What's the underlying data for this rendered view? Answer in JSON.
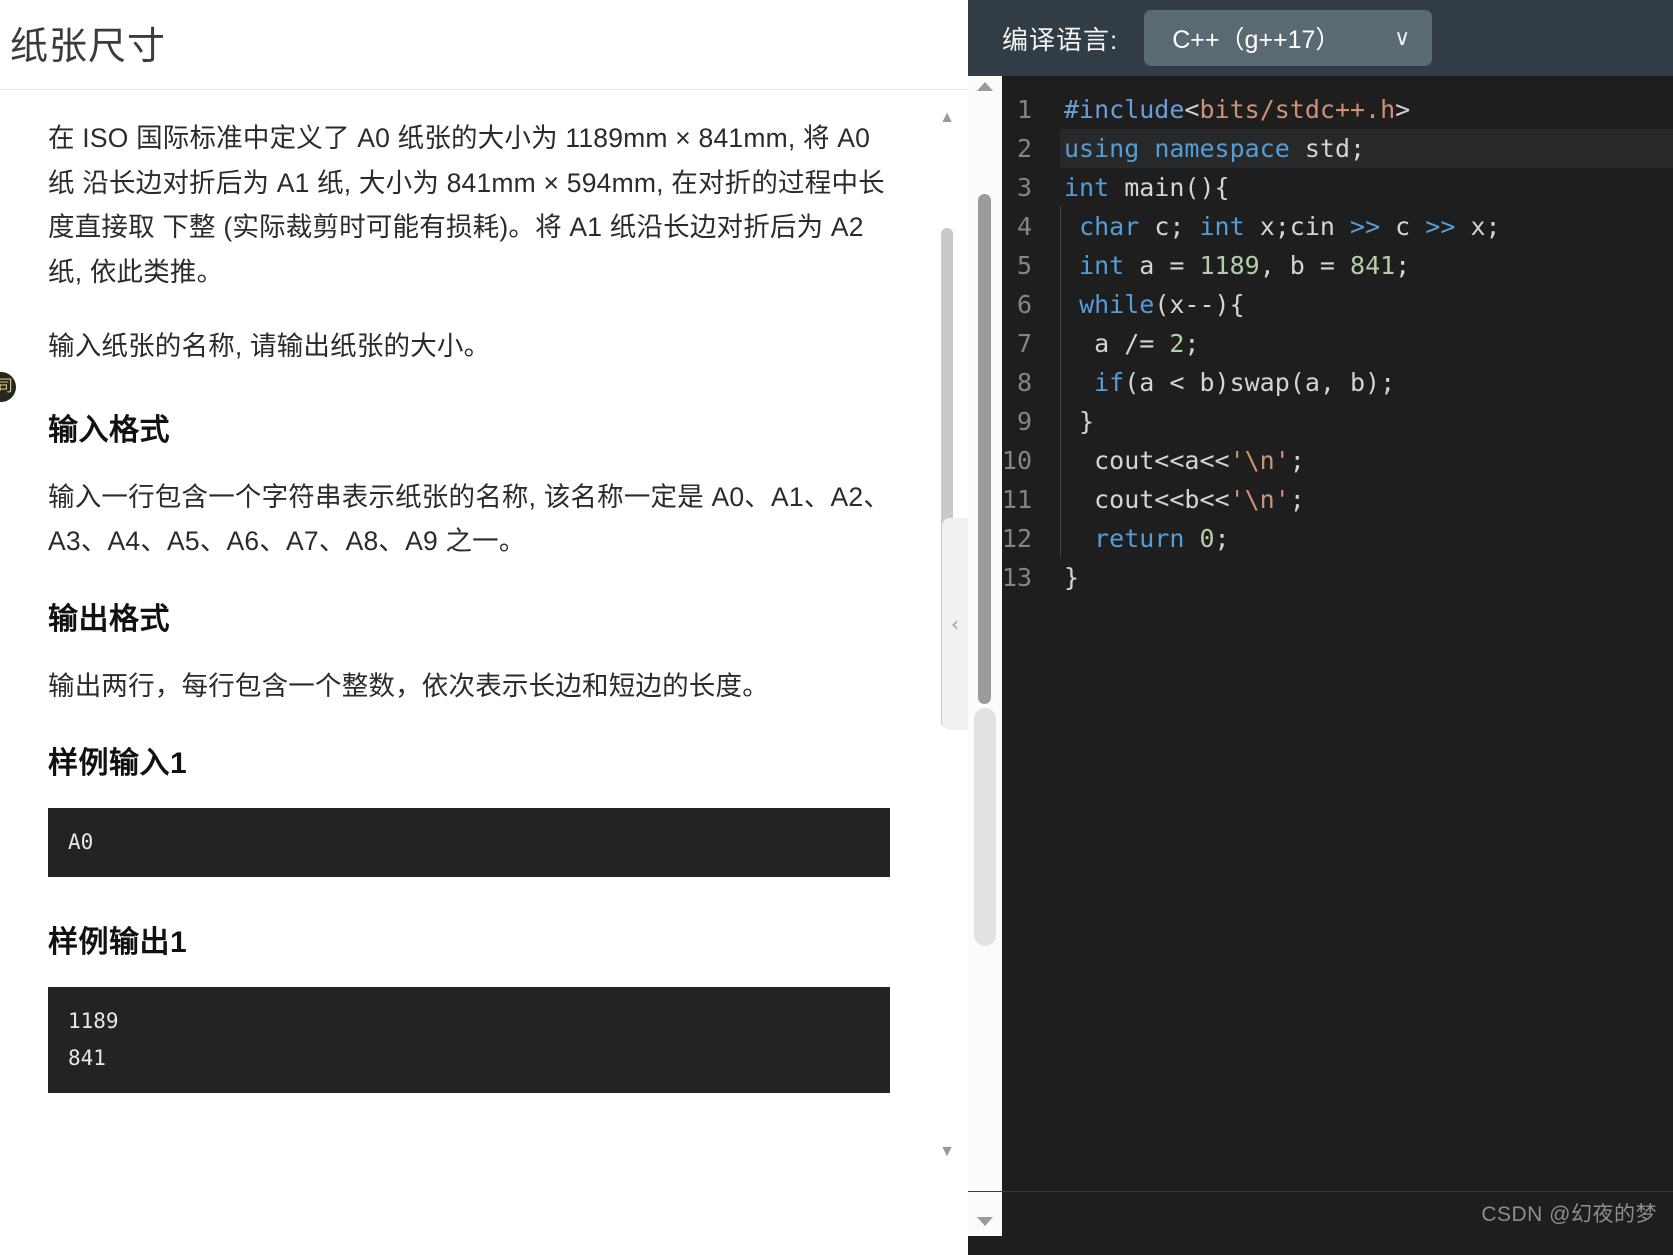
{
  "problem": {
    "title": "纸张尺寸",
    "paragraphs": [
      "在 ISO 国际标准中定义了 A0 纸张的大小为 1189mm × 841mm, 将 A0 纸 沿长边对折后为 A1 纸, 大小为 841mm × 594mm, 在对折的过程中长度直接取 下整 (实际裁剪时可能有损耗)。将 A1 纸沿长边对折后为 A2 纸, 依此类推。",
      "输入纸张的名称, 请输出纸张的大小。"
    ],
    "input_section": {
      "heading": "输入格式",
      "text": "输入一行包含一个字符串表示纸张的名称, 该名称一定是 A0、A1、A2、 A3、A4、A5、A6、A7、A8、A9 之一。"
    },
    "output_section": {
      "heading": "输出格式",
      "text": "输出两行，每行包含一个整数，依次表示长边和短边的长度。"
    },
    "sample_input": {
      "heading": "样例输入1",
      "content": "A0"
    },
    "sample_output": {
      "heading": "样例输出1",
      "content": "1189\n841"
    },
    "badge_glyph": "司"
  },
  "scrollbar": {
    "up_arrow": "▲",
    "down_arrow": "▼",
    "collapse_chevron": "‹"
  },
  "editor": {
    "language_label": "编译语言:",
    "language_value": "C++（g++17）",
    "caret": "∨",
    "lines": [
      {
        "n": "1",
        "highlight": false
      },
      {
        "n": "2",
        "highlight": true
      },
      {
        "n": "3",
        "highlight": false
      },
      {
        "n": "4",
        "highlight": false
      },
      {
        "n": "5",
        "highlight": false
      },
      {
        "n": "6",
        "highlight": false
      },
      {
        "n": "7",
        "highlight": false
      },
      {
        "n": "8",
        "highlight": false
      },
      {
        "n": "9",
        "highlight": false
      },
      {
        "n": "10",
        "highlight": false
      },
      {
        "n": "11",
        "highlight": false
      },
      {
        "n": "12",
        "highlight": false
      },
      {
        "n": "13",
        "highlight": false
      }
    ],
    "code_text": [
      "#include<bits/stdc++.h>",
      "using namespace std;",
      "int main(){",
      " char c; int x;cin >> c >> x;",
      " int a = 1189, b = 841;",
      " while(x--){",
      "  a /= 2;",
      "  if(a < b)swap(a, b);",
      " }",
      "  cout<<a<<'\\n';",
      "  cout<<b<<'\\n';",
      "  return 0;",
      "}"
    ],
    "colors": {
      "background": "#1e1e1e",
      "header": "#323c44",
      "select": "#5b6a72",
      "keyword": "#569cd6",
      "string": "#ce9178",
      "number": "#b5cea8",
      "preprocessor": "#c586c0",
      "plain": "#d4d4d4",
      "linenumber": "#858585"
    }
  },
  "watermark": "CSDN @幻夜的梦"
}
